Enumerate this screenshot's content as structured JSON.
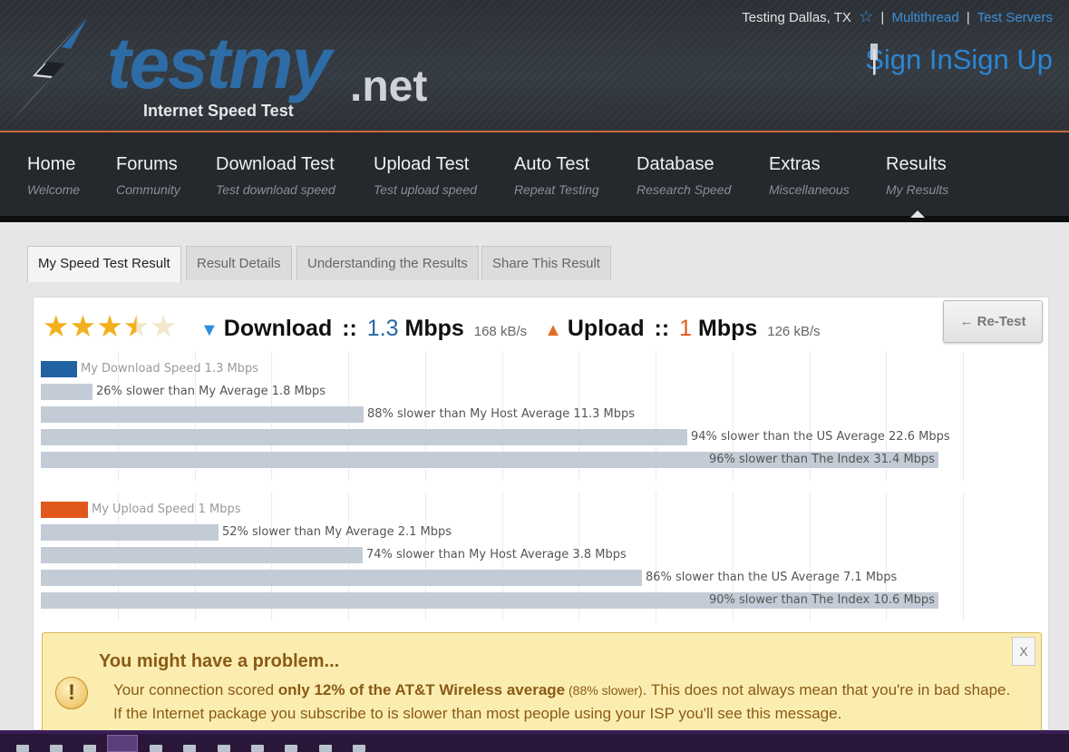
{
  "header": {
    "logo_text": "testmy",
    "logo_suffix": ".net",
    "logo_tagline": "Internet Speed Test",
    "location": "Testing Dallas, TX",
    "multithread": "Multithread",
    "test_servers": "Test Servers",
    "sign_in": "Sign In",
    "sign_up": "Sign Up"
  },
  "nav": [
    {
      "title": "Home",
      "sub": "Welcome"
    },
    {
      "title": "Forums",
      "sub": "Community"
    },
    {
      "title": "Download Test",
      "sub": "Test download speed"
    },
    {
      "title": "Upload Test",
      "sub": "Test upload speed"
    },
    {
      "title": "Auto Test",
      "sub": "Repeat Testing"
    },
    {
      "title": "Database",
      "sub": "Research Speed"
    },
    {
      "title": "Extras",
      "sub": "Miscellaneous"
    },
    {
      "title": "Results",
      "sub": "My Results"
    }
  ],
  "tabs": [
    "My Speed Test Result",
    "Result Details",
    "Understanding the Results",
    "Share This Result"
  ],
  "result": {
    "rating_stars": 3.5,
    "download_label": "Download",
    "download_value": "1.3",
    "download_unit": "Mbps",
    "download_kbs": "168 kB/s",
    "upload_label": "Upload",
    "upload_value": "1",
    "upload_unit": "Mbps",
    "upload_kbs": "126 kB/s",
    "sep": "::",
    "retest": "← Re-Test"
  },
  "download_bars": [
    {
      "label": "My Download Speed 1.3 Mbps",
      "value": 1.3
    },
    {
      "label": "26% slower than My Average 1.8 Mbps",
      "value": 1.8
    },
    {
      "label": "88% slower than My Host Average 11.3 Mbps",
      "value": 11.3
    },
    {
      "label": "94% slower than the US Average 22.6 Mbps",
      "value": 22.6
    },
    {
      "label": "96% slower than The Index 31.4 Mbps",
      "value": 31.4
    }
  ],
  "upload_bars": [
    {
      "label": "My Upload Speed 1 Mbps",
      "value": 1
    },
    {
      "label": "52% slower than My Average 2.1 Mbps",
      "value": 2.1
    },
    {
      "label": "74% slower than My Host Average 3.8 Mbps",
      "value": 3.8
    },
    {
      "label": "86% slower than the US Average 7.1 Mbps",
      "value": 7.1
    },
    {
      "label": "90% slower than The Index 10.6 Mbps",
      "value": 10.6
    }
  ],
  "alert": {
    "title": "You might have a problem...",
    "text_pre": "Your connection scored ",
    "text_bold": "only 12% of the AT&T Wireless average",
    "text_small": " (88% slower)",
    "text_post": ". This does not always mean that you're in bad shape. If the Internet package you subscribe to is slower than most people using your ISP you'll see this message.",
    "icon": "!",
    "close": "X"
  },
  "colors": {
    "accent_blue": "#2a86d4",
    "download": "#2162a3",
    "upload": "#e0581b",
    "comparison_bar": "#c3ccd6",
    "alert_bg": "#fbedb0"
  }
}
